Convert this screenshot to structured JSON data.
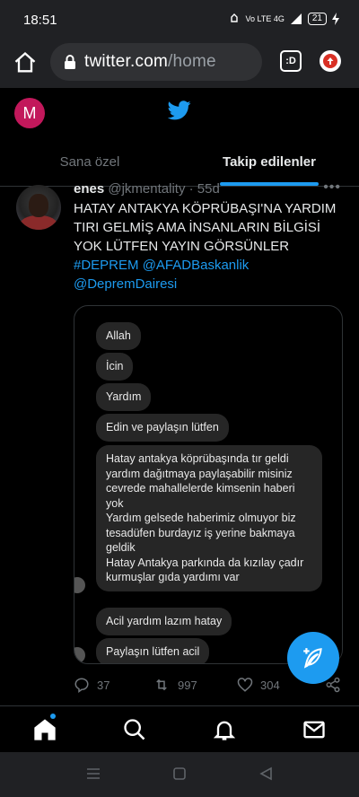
{
  "status_bar": {
    "time": "18:51",
    "signal_text": "Vo LTE 4G",
    "battery": "21"
  },
  "browser": {
    "url_domain": "twitter.com",
    "url_path": "/home",
    "tabs_label": ":D"
  },
  "twitter": {
    "account_initial": "M",
    "tabs": [
      {
        "label": "Sana özel",
        "active": false
      },
      {
        "label": "Takip edilenler",
        "active": true
      }
    ]
  },
  "tweet": {
    "name": "enes",
    "handle": "@jkmentality",
    "time": "· 55d",
    "text": "HATAY ANTAKYA KÖPRÜBAŞI'NA YARDIM TIRI GELMİŞ AMA İNSANLARIN BİLGİSİ YOK LÜTFEN YAYIN GÖRSÜNLER",
    "hashtag": "#DEPREM",
    "mention1": "@AFADBaskanlik",
    "mention2": "@DepremDairesi",
    "media_messages": [
      "Allah",
      "İcin",
      "Yardım",
      "Edin ve paylaşın lütfen",
      "Hatay antakya köprübaşında tır geldi yardım dağıtmaya paylaşabilir misiniz cevrede mahallelerde kimsenin haberi yok\nYardım gelsede haberimiz olmuyor biz tesadüfen burdayız iş yerine bakmaya geldik\nHatay Antakya parkında da kızılay çadır kurmuşlar gıda yardımı var",
      "Acil yardım lazım hatay",
      "Paylaşın lütfen acil"
    ],
    "replies": "37",
    "retweets": "997",
    "likes": "304"
  },
  "colors": {
    "accent": "#1d9bf0",
    "bg": "#000000",
    "muted": "#71767b",
    "avatar_m": "#c2185b"
  },
  "icons": [
    "home-icon",
    "lock-icon",
    "twitter-bird-icon",
    "reply-icon",
    "retweet-icon",
    "like-icon",
    "share-icon",
    "compose-icon",
    "search-icon",
    "bell-icon",
    "mail-icon"
  ]
}
